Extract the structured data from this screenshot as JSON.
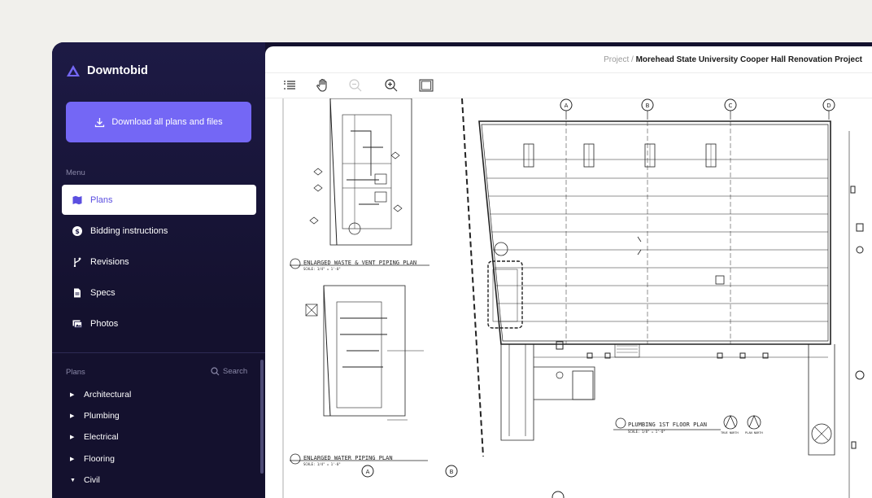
{
  "app": {
    "brand_name": "Downtobid",
    "brand_color": "#7467f5"
  },
  "sidebar": {
    "download_label": "Download all plans and files",
    "menu_label": "Menu",
    "menu": [
      {
        "label": "Plans",
        "icon": "map-icon",
        "active": true
      },
      {
        "label": "Bidding instructions",
        "icon": "dollar-icon",
        "active": false
      },
      {
        "label": "Revisions",
        "icon": "branch-icon",
        "active": false
      },
      {
        "label": "Specs",
        "icon": "document-icon",
        "active": false
      },
      {
        "label": "Photos",
        "icon": "photos-icon",
        "active": false
      }
    ],
    "plans_label": "Plans",
    "search_label": "Search",
    "plans": [
      {
        "label": "Architectural",
        "expanded": false
      },
      {
        "label": "Plumbing",
        "expanded": false
      },
      {
        "label": "Electrical",
        "expanded": false
      },
      {
        "label": "Flooring",
        "expanded": false
      },
      {
        "label": "Civil",
        "expanded": true
      }
    ]
  },
  "breadcrumb": {
    "prefix": "Project",
    "separator": "/",
    "project": "Morehead State University Cooper Hall Renovation Project"
  },
  "toolbar": {
    "tools": [
      "list-icon",
      "hand-icon",
      "zoom-out-icon",
      "zoom-in-icon",
      "panel-icon"
    ]
  },
  "drawing": {
    "caption_waste": "ENLARGED WASTE & VENT PIPING PLAN",
    "caption_water": "ENLARGED WATER PIPING PLAN",
    "caption_plumbing": "PLUMBING 1ST FLOOR PLAN",
    "scale_text": "SCALE: 1/4\" = 1'-0\"",
    "scale_text_main": "SCALE: 1/8\" = 1'-0\"",
    "north_true": "TRUE NORTH",
    "north_plan": "PLAN NORTH",
    "column_labels": [
      "A",
      "B",
      "C",
      "D"
    ],
    "bottom_labels": [
      "A",
      "B"
    ]
  }
}
